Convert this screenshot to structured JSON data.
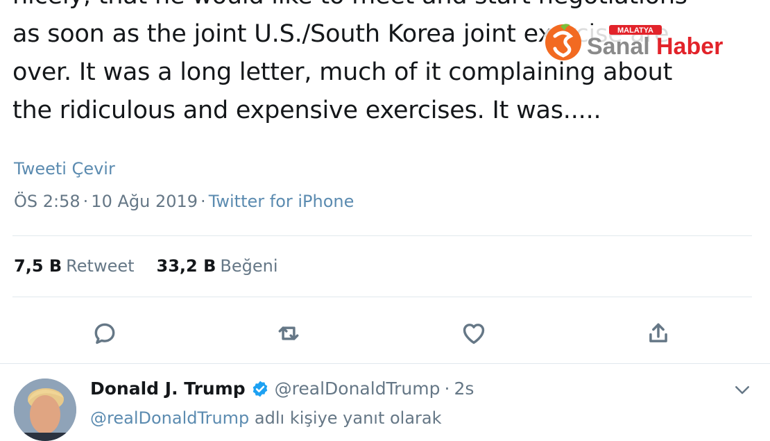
{
  "tweet": {
    "lines": [
      "nicely, that he would like to meet and start negotiations",
      "as soon as the joint U.S./South Korea joint exercise are",
      "over. It was a long letter, much of it complaining about",
      "the ridiculous and expensive exercises. It was....."
    ],
    "translate_label": "Tweeti Çevir",
    "time": "ÖS 2:58",
    "date": "10 Ağu 2019",
    "separator": "·",
    "source": "Twitter for iPhone"
  },
  "stats": {
    "retweets_count": "7,5 B",
    "retweets_label": "Retweet",
    "likes_count": "33,2 B",
    "likes_label": "Beğeni"
  },
  "actions": {
    "icons": [
      "reply-icon",
      "retweet-icon",
      "like-icon",
      "share-icon"
    ]
  },
  "reply": {
    "name": "Donald J. Trump",
    "handle": "@realDonaldTrump",
    "separator": "·",
    "time": "2s",
    "replying_to_mention": "@realDonaldTrump",
    "replying_to_text": " adlı kişiye yanıt olarak"
  },
  "watermark": {
    "small": "MALATYA",
    "brand_part1": "Sanal",
    "brand_part2": "Haber"
  },
  "colors": {
    "link": "#5b8bb0",
    "muted": "#657786",
    "verified": "#1da1f2",
    "brand_orange": "#f26a21",
    "brand_red": "#e2232a"
  }
}
